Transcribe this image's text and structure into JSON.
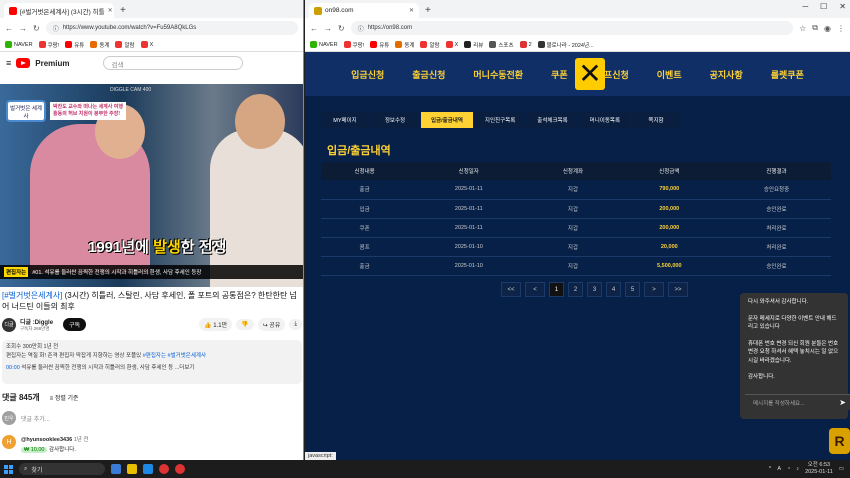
{
  "left": {
    "tab_title": "[#벌거벗은세계사] (3시간) 히틀",
    "url": "https://www.youtube.com/watch?v=Fu59A8QkLGs",
    "bookmarks": [
      "NAVER",
      "쿠팡!",
      "유튜",
      "동계",
      "알람",
      "X",
      "리뷰",
      "스포츠",
      "2",
      "블로나라"
    ],
    "yt_logo": "Premium",
    "search_placeholder": "검색",
    "video_overlay": {
      "logo": "벌거벗은 세계사",
      "info_line1": "박찬도 교수와 떠나는 세계사 여행",
      "info_line2": "흥동의 허브 지원이 붕부한 주장!",
      "top_label": "DIGGLE CAM 400",
      "big_text_pre": "1991년에 ",
      "big_text_hl": "발생",
      "big_text_post": "한 전쟁",
      "bar_tag": "편집자는",
      "bar_text": "#01. 석유를 둘러싼 끔찍한 전쟁의 시작과 히틀러의 환생, 사담 후세인 등장"
    },
    "title_tag": "[#벌거벗은세계사]",
    "title_rest": " (3시간) 히틀러, 스탈린, 사담 후세인, 폴 포트의 공통점은? 한탄한탄 넘어 너드틴 이들의 최후",
    "channel": {
      "avatar": "디글",
      "name": "디글 :Diggle",
      "subs": "구독자 268만명",
      "subscribe": "구독",
      "likes": "1.1만",
      "share": "공유",
      "download": "오프"
    },
    "desc": {
      "views": "조회수 300만회 1년 전",
      "line1": "편집자는 역질 화! 존격 편집자 딱잡게 지향하는 영상 포플있",
      "hashtags": "#편집자는 #벌거벗은세계사",
      "time": "00:00",
      "line2": "석유를 둘러싼 끔찍한 전쟁의 시작과 히틀러의 환생, 사담 후세인 등 ...더보기"
    },
    "comments_title": "댓글 845개",
    "sort": "정렬 기준",
    "add_comment": "댓글 추가...",
    "add_avatar": "민우",
    "comment": {
      "avatar": "H",
      "user": "@hyunsooklee3436",
      "time": "1년 전",
      "badge": "₩ 10,00",
      "text": "감사합니다."
    }
  },
  "right": {
    "tab_title": "on98.com",
    "url": "https://on98.com",
    "bookmarks": [
      "NAVER",
      "쿠팡!",
      "유튜",
      "동계",
      "알람",
      "X",
      "리뷰",
      "스포츠",
      "2",
      "블로나라 - 2024년..."
    ],
    "nav": [
      "입금신청",
      "출금신청",
      "머니수동전환",
      "쿠폰",
      "콤프신청",
      "이벤트",
      "공지사항",
      "룰렛쿠폰"
    ],
    "subnav": [
      "MY페이지",
      "정보수정",
      "입금/출금내역",
      "지인친구목록",
      "출석체크목록",
      "머니이동목록",
      "쪽지함"
    ],
    "active_subnav": 2,
    "page_title": "입금/출금내역",
    "columns": [
      "신청내용",
      "신청일자",
      "신청계좌",
      "신청금액",
      "진행결과"
    ],
    "rows": [
      [
        "출금",
        "2025-01-11",
        "지갑",
        "790,000",
        "승인요청중"
      ],
      [
        "입금",
        "2025-01-11",
        "지갑",
        "200,000",
        "승인완료"
      ],
      [
        "쿠폰",
        "2025-01-11",
        "지갑",
        "200,000",
        "처리완료"
      ],
      [
        "콤프",
        "2025-01-10",
        "지갑",
        "20,000",
        "처리완료"
      ],
      [
        "출금",
        "2025-01-10",
        "지갑",
        "5,500,000",
        "승인완료"
      ]
    ],
    "pager": [
      "<<",
      "<",
      "1",
      "2",
      "3",
      "4",
      "5",
      ">",
      ">>"
    ],
    "active_page": "1",
    "status_bar": "javascript:",
    "chat": {
      "lines": [
        "다시 와주셔서 감사합니다.",
        "문자 메세지로 다양한 이벤트 안내 해드리고 있습니다",
        "휴대폰 번호 변경 되신 회원 분들은 번호 변경 요청 하셔서 혜택 놓치시는 일 없으시길 바라겠습니다.",
        "감사합니다."
      ],
      "placeholder": "메시지를 작성하세요..."
    }
  },
  "taskbar": {
    "search": "찾기",
    "time": "오전 6:53",
    "date": "2025-01-11",
    "lang": "A"
  }
}
